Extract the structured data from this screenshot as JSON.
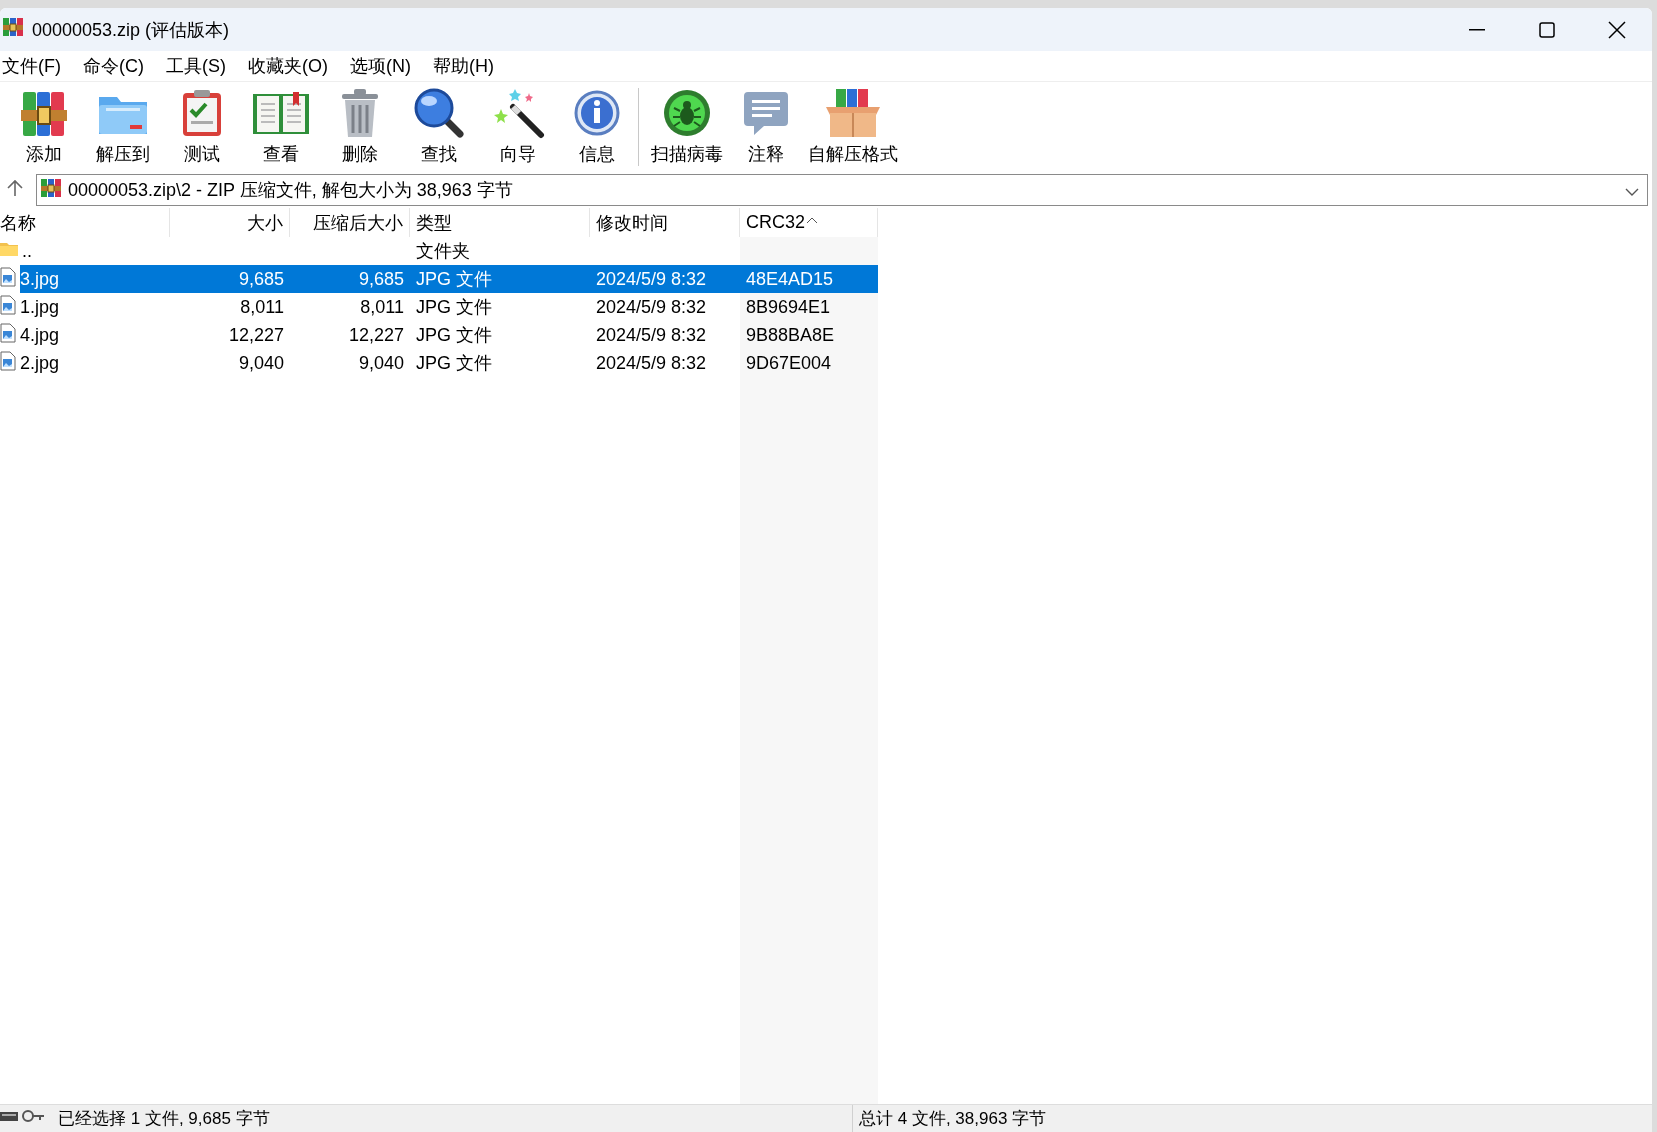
{
  "window": {
    "title": "00000053.zip (评估版本)"
  },
  "menu": [
    {
      "label": "文件(F)"
    },
    {
      "label": "命令(C)"
    },
    {
      "label": "工具(S)"
    },
    {
      "label": "收藏夹(O)"
    },
    {
      "label": "选项(N)"
    },
    {
      "label": "帮助(H)"
    }
  ],
  "toolbar": [
    {
      "label": "添加"
    },
    {
      "label": "解压到"
    },
    {
      "label": "测试"
    },
    {
      "label": "查看"
    },
    {
      "label": "删除"
    },
    {
      "label": "查找"
    },
    {
      "label": "向导"
    },
    {
      "label": "信息"
    },
    {
      "label": "扫描病毒"
    },
    {
      "label": "注释"
    },
    {
      "label": "自解压格式"
    }
  ],
  "address": {
    "path": "00000053.zip\\2 - ZIP 压缩文件, 解包大小为 38,963 字节"
  },
  "table": {
    "columns": [
      {
        "label": "名称",
        "sorted": false
      },
      {
        "label": "大小",
        "sorted": false
      },
      {
        "label": "压缩后大小",
        "sorted": false
      },
      {
        "label": "类型",
        "sorted": false
      },
      {
        "label": "修改时间",
        "sorted": false
      },
      {
        "label": "CRC32",
        "sorted": true
      }
    ],
    "rows": [
      {
        "kind": "folder",
        "name": "..",
        "type": "文件夹",
        "selected": false
      },
      {
        "kind": "file",
        "name": "3.jpg",
        "size": "9,685",
        "packed": "9,685",
        "type": "JPG 文件",
        "modified": "2024/5/9 8:32",
        "crc": "48E4AD15",
        "selected": true
      },
      {
        "kind": "file",
        "name": "1.jpg",
        "size": "8,011",
        "packed": "8,011",
        "type": "JPG 文件",
        "modified": "2024/5/9 8:32",
        "crc": "8B9694E1",
        "selected": false
      },
      {
        "kind": "file",
        "name": "4.jpg",
        "size": "12,227",
        "packed": "12,227",
        "type": "JPG 文件",
        "modified": "2024/5/9 8:32",
        "crc": "9B88BA8E",
        "selected": false
      },
      {
        "kind": "file",
        "name": "2.jpg",
        "size": "9,040",
        "packed": "9,040",
        "type": "JPG 文件",
        "modified": "2024/5/9 8:32",
        "crc": "9D67E004",
        "selected": false
      }
    ]
  },
  "status_bar": {
    "selection": "已经选择 1 文件, 9,685 字节",
    "total": "总计 4 文件, 38,963 字节"
  }
}
